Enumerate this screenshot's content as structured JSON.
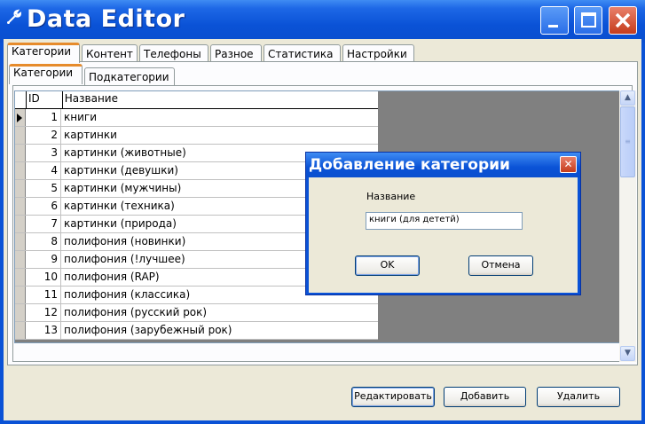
{
  "window": {
    "title": "Data Editor",
    "app_icon": "wrench-icon"
  },
  "tabs": [
    "Категории",
    "Контент",
    "Телефоны",
    "Разное",
    "Статистика",
    "Настройки"
  ],
  "subtabs": [
    "Категории",
    "Подкатегории"
  ],
  "grid": {
    "columns": [
      "ID",
      "Название"
    ],
    "rows": [
      {
        "id": "1",
        "name": "книги"
      },
      {
        "id": "2",
        "name": "картинки"
      },
      {
        "id": "3",
        "name": "картинки (животные)"
      },
      {
        "id": "4",
        "name": "картинки (девушки)"
      },
      {
        "id": "5",
        "name": "картинки (мужчины)"
      },
      {
        "id": "6",
        "name": "картинки (техника)"
      },
      {
        "id": "7",
        "name": "картинки (природа)"
      },
      {
        "id": "8",
        "name": "полифония (новинки)"
      },
      {
        "id": "9",
        "name": "полифония (!лучшее)"
      },
      {
        "id": "10",
        "name": "полифония (RAP)"
      },
      {
        "id": "11",
        "name": "полифония (классика)"
      },
      {
        "id": "12",
        "name": "полифония (русский рок)"
      },
      {
        "id": "13",
        "name": "полифония (зарубежный рок)"
      }
    ]
  },
  "buttons": {
    "edit": "Редактировать",
    "add": "Добавить",
    "delete": "Удалить"
  },
  "dialog": {
    "title": "Добавление категории",
    "label": "Название",
    "input_value": "книги (для дететй)",
    "ok": "OK",
    "cancel": "Отмена"
  },
  "colors": {
    "titlebar": "#0a52d6",
    "window_bg": "#ece9d8",
    "active_tab_accent": "#e68b2c"
  }
}
